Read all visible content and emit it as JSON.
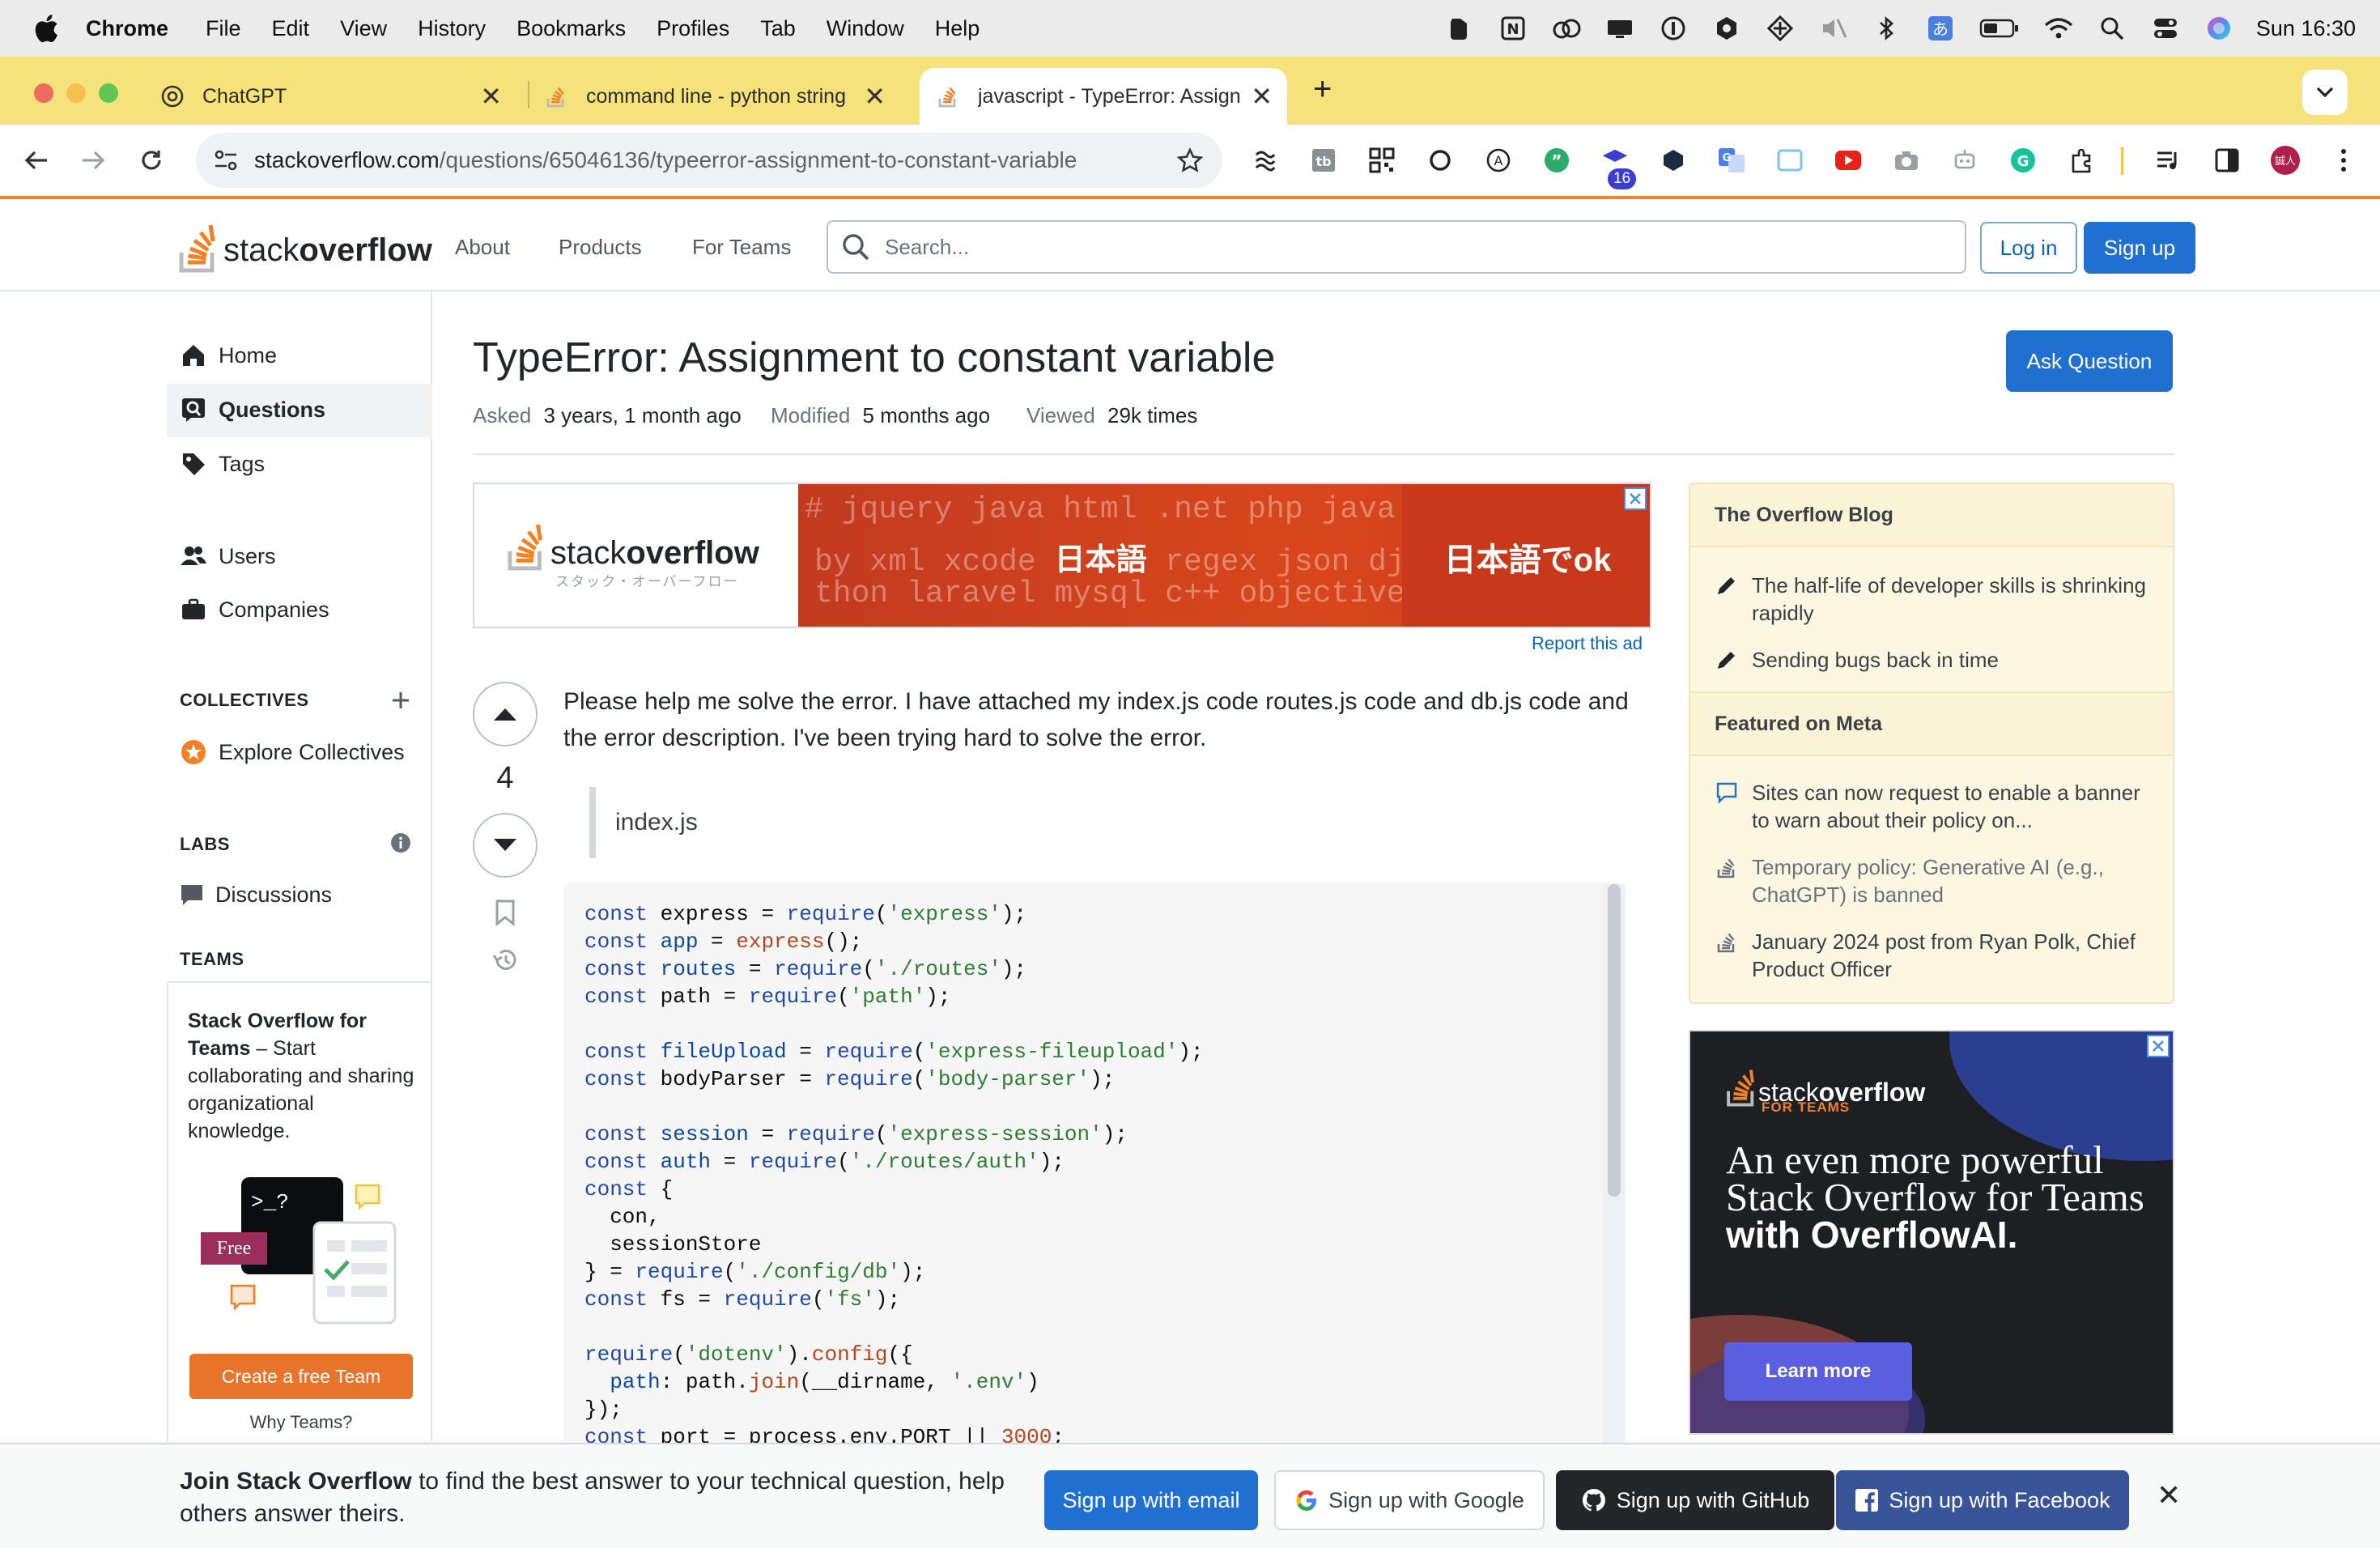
{
  "menubar": {
    "app": "Chrome",
    "items": [
      "File",
      "Edit",
      "View",
      "History",
      "Bookmarks",
      "Profiles",
      "Tab",
      "Window",
      "Help"
    ],
    "clock": "Sun  16:30"
  },
  "tabs": [
    {
      "title": "ChatGPT",
      "close": "✕"
    },
    {
      "title": "command line - python string",
      "close": "✕"
    },
    {
      "title": "javascript - TypeError: Assign",
      "close": "✕"
    }
  ],
  "new_tab": "+",
  "address": {
    "host": "stackoverflow.com",
    "path": "/questions/65046136/typeerror-assignment-to-constant-variable"
  },
  "toolbar_badge": "16",
  "so_header": {
    "logo_word_light": "stack",
    "logo_word_bold": "overflow",
    "nav": [
      "About",
      "Products",
      "For Teams"
    ],
    "search_placeholder": "Search...",
    "login": "Log in",
    "signup": "Sign up"
  },
  "sidebar": {
    "nav": [
      "Home",
      "Questions",
      "Tags",
      "Users",
      "Companies"
    ],
    "collectives_heading": "COLLECTIVES",
    "explore_collectives": "Explore Collectives",
    "labs_heading": "LABS",
    "discussions": "Discussions",
    "teams_heading": "TEAMS",
    "teams_title": "Stack Overflow for Teams",
    "teams_desc": " – Start collaborating and sharing organizational knowledge.",
    "free_badge": "Free",
    "terminal_prompt": ">_?",
    "create_team": "Create a free Team",
    "why_teams": "Why Teams?"
  },
  "question": {
    "title": "TypeError: Assignment to constant variable",
    "ask_button": "Ask Question",
    "asked_label": "Asked",
    "asked_value": "3 years, 1 month ago",
    "modified_label": "Modified",
    "modified_value": "5 months ago",
    "viewed_label": "Viewed",
    "viewed_value": "29k times",
    "votes": "4",
    "body": "Please help me solve the error. I have attached my index.js code routes.js code and db.js code and the error description. I've been trying hard to solve the error.",
    "quote": "index.js"
  },
  "ad_banner": {
    "logo_light": "stack",
    "logo_bold": "overflow",
    "logo_sub": "スタック・オーバーフロー",
    "line1": "# jquery java html .net php java",
    "line2_a": "by xml xcode ",
    "line2_jp": "日本語",
    "line2_b": " regex json dj",
    "line3": "thon laravel mysql c++ objective",
    "tagline": "日本語でok",
    "report": "Report this ad"
  },
  "right": {
    "blog_heading": "The Overflow Blog",
    "blog_items": [
      "The half-life of developer skills is shrinking rapidly",
      "Sending bugs back in time"
    ],
    "meta_heading": "Featured on Meta",
    "meta_items": [
      "Sites can now request to enable a banner to warn about their policy on...",
      "Temporary policy: Generative AI (e.g., ChatGPT) is banned",
      "January 2024 post from Ryan Polk, Chief Product Officer"
    ],
    "teams_ad_logo_light": "stack",
    "teams_ad_logo_bold": "overflow",
    "teams_ad_sub": "FOR TEAMS",
    "teams_ad_headline_1": "An even more powerful Stack Overflow for Teams",
    "teams_ad_headline_2": "with OverflowAI.",
    "teams_ad_cta": "Learn more"
  },
  "signup_bar": {
    "bold": "Join Stack Overflow",
    "rest": " to find the best answer to your technical question, help others answer theirs.",
    "email": "Sign up with email",
    "google": "Sign up with Google",
    "github": "Sign up with GitHub",
    "facebook": "Sign up with Facebook",
    "close": "✕"
  },
  "colors": {
    "so_orange": "#f48024",
    "so_blue": "#1f70d1",
    "tab_strip": "#f6e27a",
    "blog_bg": "#fdf7e2",
    "github_btn": "#232629",
    "facebook_btn": "#385499"
  }
}
